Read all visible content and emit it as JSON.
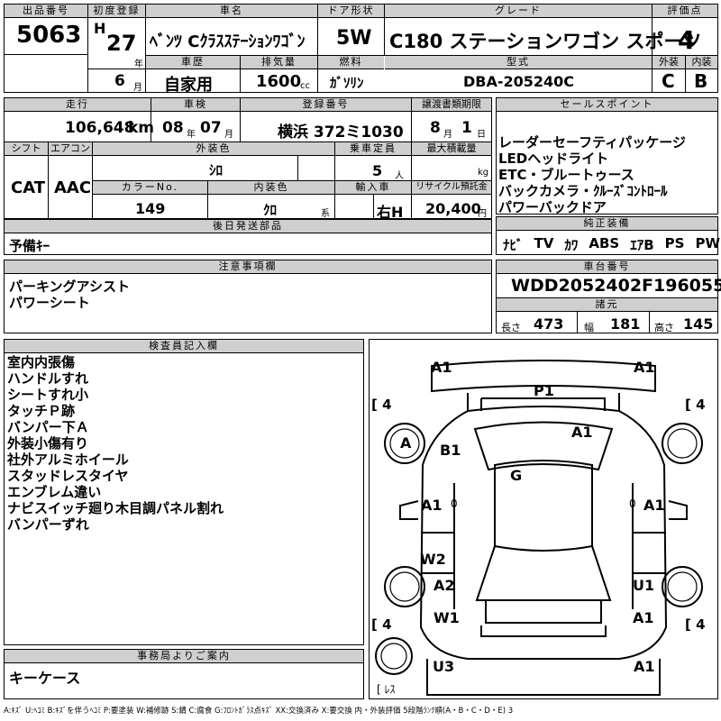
{
  "header": {
    "lot_label": "出品番号",
    "lot": "5063",
    "reg_label": "初度登録",
    "era": "H",
    "year": "27",
    "year_unit": "年",
    "month": "6",
    "month_unit": "月",
    "car_name_label": "車名",
    "car_name": "ﾍﾞﾝﾂ Cｸﾗｽｽﾃｰｼｮﾝﾜｺﾞﾝ",
    "door_label": "ドア形状",
    "door": "5W",
    "grade_label": "グレード",
    "grade": "C180 ステーションワゴン スポーツ",
    "score_label": "評価点",
    "score": "4",
    "history_label": "車歴",
    "history": "自家用",
    "disp_label": "排気量",
    "disp": "1600",
    "disp_unit": "cc",
    "fuel_label": "燃料",
    "fuel": "ｶﾞｿﾘﾝ",
    "model_label": "型式",
    "model": "DBA-205240C",
    "ext_label": "外装",
    "ext_grade": "C",
    "int_label": "内装",
    "int_grade": "B"
  },
  "row2": {
    "mileage_label": "走行",
    "mileage": "106,648",
    "mileage_unit": "km",
    "inspect_label": "車検",
    "inspect_y": "08",
    "inspect_y_unit": "年",
    "inspect_m": "07",
    "inspect_m_unit": "月",
    "plate_label": "登録番号",
    "plate": "横浜 372ミ1030",
    "transfer_label": "譲渡書類期限",
    "transfer_m": "8",
    "transfer_m_unit": "月",
    "transfer_d": "1",
    "transfer_d_unit": "日",
    "shift_label": "シフト",
    "shift": "CAT",
    "ac_label": "エアコン",
    "ac": "AAC",
    "color_label": "外装色",
    "color": "ｼﾛ",
    "capacity_label": "乗車定員",
    "capacity": "5",
    "capacity_unit": "人",
    "load_label": "最大積載量",
    "load_unit": "kg",
    "color_no_label": "カラーNo.",
    "color_no": "149",
    "int_color_label": "内装色",
    "int_color": "ｸﾛ",
    "int_color_unit": "系",
    "import_label": "輸入車",
    "handle": "右H",
    "recycle_label": "リサイクル預託金",
    "recycle": "20,400",
    "recycle_unit": "円"
  },
  "sales": {
    "label": "セールスポイント",
    "items": [
      "レーダーセーフティパッケージ",
      "LEDヘッドライト",
      "ETC・ブルートゥース",
      "バックカメラ・ｸﾙｰｽﾞｺﾝﾄﾛｰﾙ",
      "パワーバックドア"
    ]
  },
  "later": {
    "label": "後日発送部品",
    "value": "予備ｷｰ"
  },
  "equip": {
    "label": "純正装備",
    "items": [
      "ﾅﾋﾞ",
      "TV",
      "ｶﾜ",
      "ABS",
      "ｴｱB",
      "PS",
      "PW"
    ]
  },
  "notes": {
    "label": "注意事項欄",
    "items": [
      "パーキングアシスト",
      "パワーシート"
    ]
  },
  "vin": {
    "label": "車台番号",
    "value": "WDD2052402F196055"
  },
  "specs": {
    "label": "諸元",
    "len_label": "長さ",
    "len": "473",
    "wid_label": "幅",
    "wid": "181",
    "hgt_label": "高さ",
    "hgt": "145"
  },
  "inspector": {
    "label": "検査員記入欄",
    "items": [
      "室内内張傷",
      "ハンドルすれ",
      "シートすれ小",
      "タッチＰ跡",
      "バンパー下Ａ",
      "外装小傷有り",
      "社外アルミホイール",
      "スタッドレスタイヤ",
      "エンブレム違い",
      "ナビスイッチ廻り木目調パネル割れ",
      "バンパーずれ"
    ]
  },
  "office": {
    "label": "事務局よりご案内",
    "value": "キーケース"
  },
  "diagram": {
    "marks": {
      "front_left": "A1",
      "front_right": "A1",
      "bonnet": "P1",
      "front_left_wheel": "A",
      "left_front_fender": "B1",
      "front_right_panel": "A1",
      "roof": "G",
      "left_door_front": "A1",
      "right_door_front": "A1",
      "left_door_rear": "W2",
      "left_rear_wheel": "A2",
      "right_rear_wheel": "U1",
      "left_rear": "W1",
      "right_rear": "A1",
      "rear_left": "U3",
      "rear_right": "A1"
    },
    "tires": {
      "fl": "4",
      "fr": "4",
      "rl": "4",
      "rr": "4",
      "spare": "ﾚｽ"
    },
    "door_zero": "0"
  },
  "legend": "A:ｷｽﾞ  U:ﾍｺﾐ  B:ｷｽﾞを伴うﾍｺﾐ  P:要塗装  W:補修跡  S:錆  C:腐食  G:ﾌﾛﾝﾄｶﾞﾗｽ点ｷｽﾞ  XX:交換済み  X:要交換  内・外装評価  5段階ﾗﾝｸ順(A・B・C・D・E) 3"
}
